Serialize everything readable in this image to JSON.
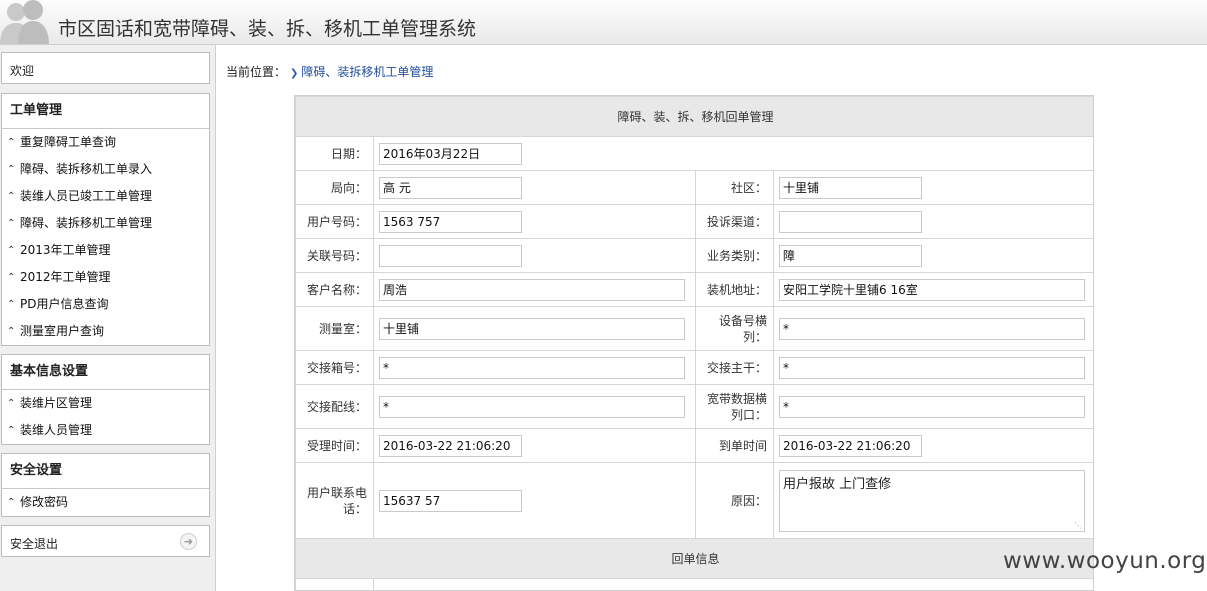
{
  "header": {
    "title": "市区固话和宽带障碍、装、拆、移机工单管理系统"
  },
  "sidebar": {
    "welcome": "欢迎",
    "groups": [
      {
        "title": "工单管理",
        "items": [
          {
            "label": "重复障碍工单查询"
          },
          {
            "label": "障碍、装拆移机工单录入"
          },
          {
            "label": "装维人员已竣工工单管理"
          },
          {
            "label": "障碍、装拆移机工单管理"
          },
          {
            "label": "2013年工单管理"
          },
          {
            "label": "2012年工单管理"
          },
          {
            "label": "PD用户信息查询"
          },
          {
            "label": "测量室用户查询"
          }
        ]
      },
      {
        "title": "基本信息设置",
        "items": [
          {
            "label": "装维片区管理"
          },
          {
            "label": "装维人员管理"
          }
        ]
      },
      {
        "title": "安全设置",
        "items": [
          {
            "label": "修改密码"
          }
        ]
      }
    ],
    "logout": "安全退出"
  },
  "breadcrumb": {
    "prefix": "当前位置：",
    "current": "障碍、装拆移机工单管理"
  },
  "form": {
    "title": "障碍、装、拆、移机回单管理",
    "date_label": "日期：",
    "date_value": "2016年03月22日",
    "bureau_label": "局向：",
    "bureau_value": "高      元",
    "community_label": "社区：",
    "community_value": "十里铺",
    "phone_label": "用户号码：",
    "phone_value": "1563      757",
    "channel_label": "投诉渠道：",
    "channel_value": "",
    "related_label": "关联号码：",
    "related_value": "",
    "biztype_label": "业务类别：",
    "biztype_value": "障",
    "customer_label": "客户名称：",
    "customer_value": "周浩",
    "address_label": "装机地址：",
    "address_value": "安阳工学院十里铺6      16室",
    "room_label": "测量室：",
    "room_value": "十里铺",
    "device_label": "设备号横列：",
    "device_value": "*",
    "box_label": "交接箱号：",
    "box_value": "*",
    "trunk_label": "交接主干：",
    "trunk_value": "*",
    "dist_label": "交接配线：",
    "dist_value": "*",
    "broadband_label": "宽带数据横列口：",
    "broadband_value": "*",
    "accept_label": "受理时间：",
    "accept_value": "2016-03-22 21:06:20",
    "arrive_label": "到单时间",
    "arrive_value": "2016-03-22 21:06:20",
    "contact_label": "用户联系电话：",
    "contact_value": "15637      57",
    "reason_label": "原因：",
    "reason_value": "用户报故                    上门查修",
    "reply_title": "回单信息"
  },
  "watermark": "www.wooyun.org"
}
